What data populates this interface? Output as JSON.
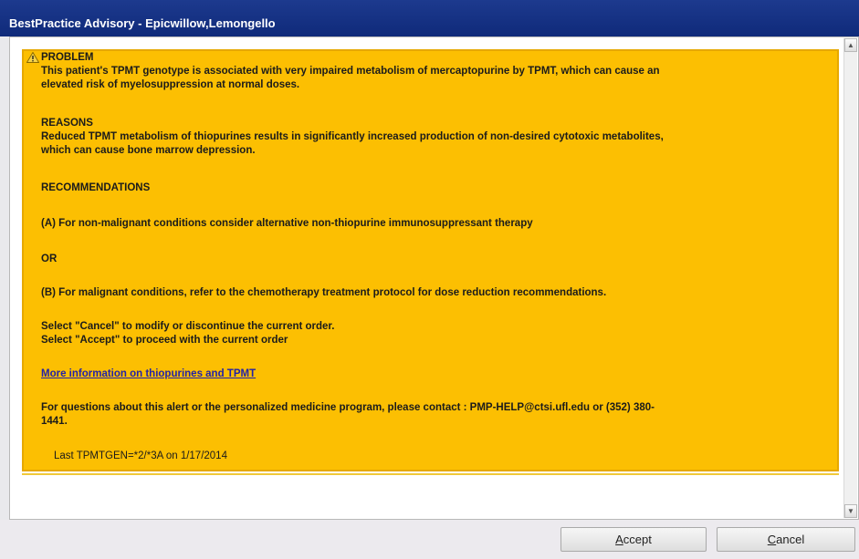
{
  "window": {
    "title": "BestPractice Advisory  -  Epicwillow,Lemongello"
  },
  "advisory": {
    "problem_heading": "PROBLEM",
    "problem_line1": "This patient's TPMT genotype is associated with very impaired metabolism of mercaptopurine by TPMT, which can cause an",
    "problem_line2": "elevated risk of myelosuppression at normal doses.",
    "reasons_heading": "REASONS",
    "reasons_line1": "Reduced TPMT metabolism of thiopurines results in significantly increased production of non-desired cytotoxic metabolites,",
    "reasons_line2": "which can cause bone marrow depression.",
    "recommendations_heading": "RECOMMENDATIONS",
    "rec_a": "(A) For non-malignant conditions consider alternative non-thiopurine immunosuppressant therapy",
    "or": "OR",
    "rec_b": "(B) For malignant conditions, refer to the chemotherapy treatment protocol for dose reduction recommendations.",
    "select_cancel": "Select \"Cancel\" to modify or discontinue the current order.",
    "select_accept": "Select \"Accept\" to proceed with the current order",
    "more_info_link": "More information on thiopurines and TPMT",
    "contact_line1": "For questions about this alert or the personalized medicine program, please contact : PMP-HELP@ctsi.ufl.edu or (352) 380-",
    "contact_line2": "1441.",
    "last_result": "Last TPMTGEN=*2/*3A on 1/17/2014",
    "background_color": "#fcbf02",
    "icon": "warning-icon"
  },
  "buttons": {
    "accept_accel": "A",
    "accept_rest": "ccept",
    "cancel_accel": "C",
    "cancel_rest": "ancel"
  }
}
